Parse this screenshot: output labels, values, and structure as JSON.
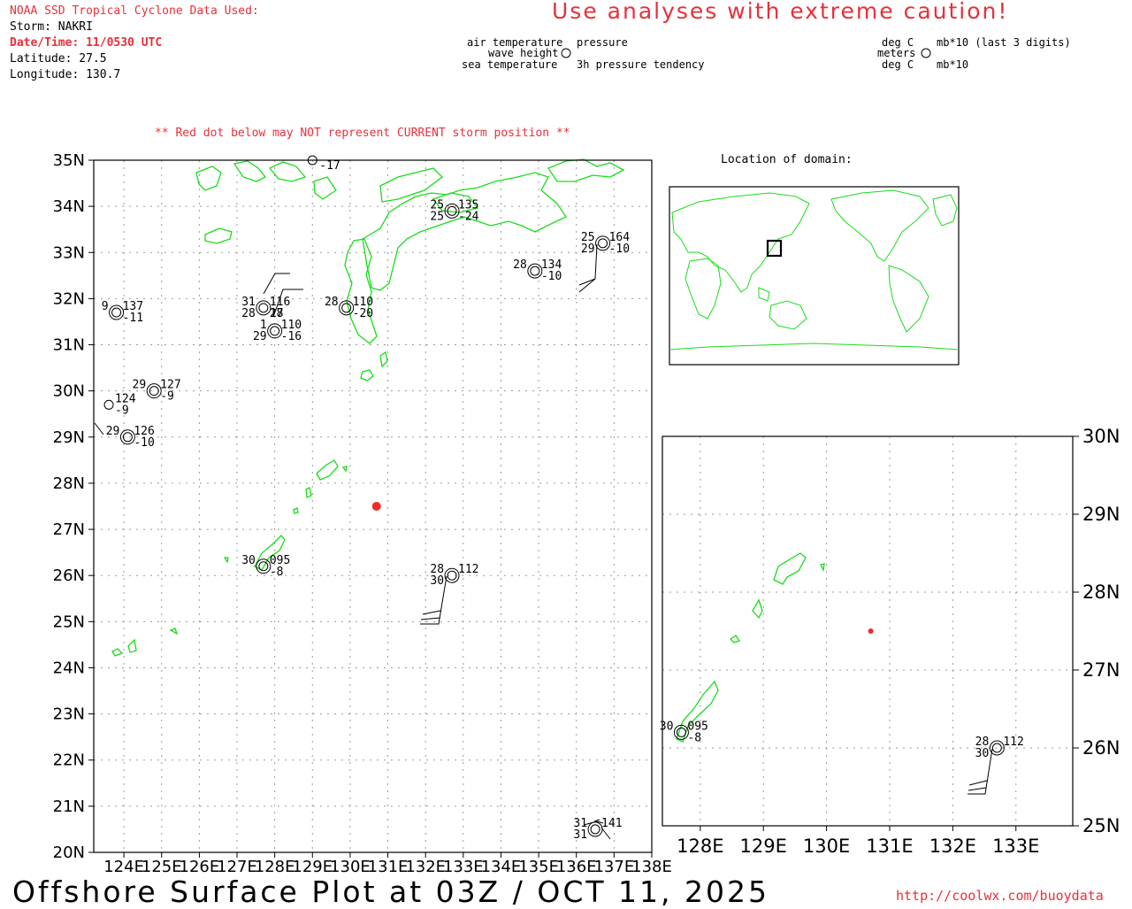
{
  "header": {
    "source_line": "NOAA SSD Tropical Cyclone Data Used:",
    "storm": "Storm: NAKRI",
    "datetime": "Date/Time: 11/0530 UTC",
    "latitude": "Latitude: 27.5",
    "longitude": "Longitude: 130.7",
    "caution": "Use analyses with extreme caution!",
    "warning": "** Red dot below may NOT represent CURRENT storm position **"
  },
  "legend": {
    "air_temperature": "air temperature",
    "wave_height": "wave height",
    "sea_temperature": "sea temperature",
    "pressure": "pressure",
    "pressure_tendency": "3h pressure tendency",
    "unit_air": "deg C",
    "unit_wave": "meters",
    "unit_sea": "deg C",
    "unit_pressure": "mb*10 (last 3 digits)",
    "unit_tendency": "mb*10"
  },
  "inset_label": "Location of domain:",
  "main_map": {
    "lat_labels": [
      "35N",
      "34N",
      "33N",
      "32N",
      "31N",
      "30N",
      "29N",
      "28N",
      "27N",
      "26N",
      "25N",
      "24N",
      "23N",
      "22N",
      "21N",
      "20N"
    ],
    "lon_labels": [
      "124E",
      "125E",
      "126E",
      "127E",
      "128E",
      "129E",
      "130E",
      "131E",
      "132E",
      "133E",
      "134E",
      "135E",
      "136E",
      "137E",
      "138E"
    ]
  },
  "zoom_map": {
    "lat_labels": [
      "30N",
      "29N",
      "28N",
      "27N",
      "26N",
      "25N"
    ],
    "lon_labels": [
      "128E",
      "129E",
      "130E",
      "131E",
      "132E",
      "133E"
    ]
  },
  "storm_marker": {
    "lat": 27.5,
    "lon": 130.7,
    "color": "#ee2b2b"
  },
  "observations": [
    {
      "lat": 35.0,
      "lon": 129.0,
      "texts": [
        "-17"
      ]
    },
    {
      "lat": 33.9,
      "lon": 132.7,
      "texts": [
        "25",
        "135",
        "25",
        "-24"
      ]
    },
    {
      "lat": 33.2,
      "lon": 136.7,
      "texts": [
        "25",
        "164",
        "29",
        "-10"
      ]
    },
    {
      "lat": 32.6,
      "lon": 134.9,
      "texts": [
        "28",
        "134",
        "-10"
      ]
    },
    {
      "lat": 31.8,
      "lon": 129.9,
      "texts": [
        "28",
        "110",
        "-20"
      ]
    },
    {
      "lat": 31.8,
      "lon": 127.7,
      "texts": [
        "31",
        "116",
        "28",
        "28",
        "17"
      ]
    },
    {
      "lat": 31.3,
      "lon": 128.0,
      "texts": [
        "1",
        "110",
        "29",
        "-16"
      ]
    },
    {
      "lat": 31.7,
      "lon": 123.8,
      "texts": [
        "9",
        "137",
        "-11"
      ]
    },
    {
      "lat": 30.0,
      "lon": 124.8,
      "texts": [
        "29",
        "127",
        "-9"
      ]
    },
    {
      "lat": 29.7,
      "lon": 123.6,
      "texts": [
        "124",
        "-9"
      ]
    },
    {
      "lat": 29.0,
      "lon": 124.1,
      "texts": [
        "29",
        "126",
        "-10"
      ]
    },
    {
      "lat": 26.2,
      "lon": 127.7,
      "texts": [
        "30",
        "095",
        "-8"
      ]
    },
    {
      "lat": 26.0,
      "lon": 132.7,
      "texts": [
        "28",
        "112",
        "30"
      ]
    },
    {
      "lat": 20.5,
      "lon": 136.5,
      "texts": [
        "31",
        "141",
        "31"
      ]
    }
  ],
  "colors": {
    "coast": "#19dc19",
    "storm": "#ee2b2b",
    "text_red": "#e8303a",
    "grid": "#888888"
  },
  "footer": {
    "title": "Offshore Surface Plot at 03Z / OCT 11, 2025",
    "url": "http://coolwx.com/buoydata"
  }
}
